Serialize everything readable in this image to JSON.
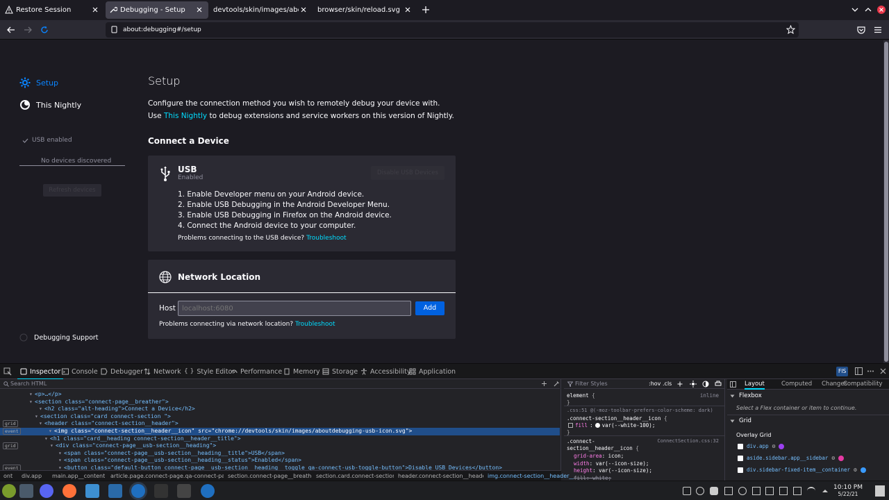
{
  "tabs": [
    {
      "label": "Restore Session",
      "active": false
    },
    {
      "label": "Debugging - Setup",
      "active": true
    },
    {
      "label": "devtools/skin/images/aboutdebugging",
      "active": false
    },
    {
      "label": "browser/skin/reload.svg",
      "active": false
    }
  ],
  "urlbar": {
    "url": "about:debugging#/setup"
  },
  "sidebar": {
    "items": [
      {
        "label": "Setup"
      },
      {
        "label": "This Nightly"
      }
    ],
    "usb_status": "USB enabled",
    "no_devices": "No devices discovered",
    "refresh_devices": "Refresh devices",
    "debugging_support": "Debugging Support"
  },
  "main": {
    "title": "Setup",
    "intro1": "Configure the connection method you wish to remotely debug your device with.",
    "intro2_pre": "Use ",
    "intro2_link": "This Nightly",
    "intro2_post": " to debug extensions and service workers on this version of Nightly.",
    "connect_heading": "Connect a Device",
    "usb": {
      "title": "USB",
      "status": "Enabled",
      "toggle_button": "Disable USB Devices",
      "steps": [
        "1.  Enable Developer menu on your Android device.",
        "2.  Enable USB Debugging in the Android Developer Menu.",
        "3.  Enable USB Debugging in Firefox on the Android device.",
        "4.  Connect the Android device to your computer."
      ],
      "problem_text": "Problems connecting to the USB device? ",
      "troubleshoot": "Troubleshoot"
    },
    "network": {
      "title": "Network Location",
      "host_label": "Host",
      "host_placeholder": "localhost:6080",
      "add_button": "Add",
      "problem_text": "Problems connecting via network location? ",
      "troubleshoot": "Troubleshoot"
    }
  },
  "devtools": {
    "tabs": [
      "Inspector",
      "Console",
      "Debugger",
      "Network",
      "Style Editor",
      "Performance",
      "Memory",
      "Storage",
      "Accessibility",
      "Application"
    ],
    "fis_label": "FIS",
    "search_placeholder": "Search HTML",
    "markup": [
      {
        "indent": 50,
        "text": "<p>…</p>"
      },
      {
        "indent": 50,
        "text": "<section class=\"connect-page__breather\">"
      },
      {
        "indent": 64,
        "text": "<h2 class=\"alt-heading\">Connect a Device</h2>"
      },
      {
        "indent": 58,
        "text": "<section class=\"card connect-section \">"
      },
      {
        "indent": 64,
        "text": "<header class=\"connect-section__header\">",
        "badge": "grid"
      },
      {
        "indent": 78,
        "text": "<img class=\"connect-section__header__icon\" src=\"chrome://devtools/skin/images/aboutdebugging-usb-icon.svg\">",
        "badge": "event",
        "selected": true
      },
      {
        "indent": 72,
        "text": "<h1 class=\"card__heading connect-section__header__title\">"
      },
      {
        "indent": 80,
        "text": "<div class=\"connect-page__usb-section__heading\">",
        "badge": "grid"
      },
      {
        "indent": 92,
        "text": "<span class=\"connect-page__usb-section__heading__title\">USB</span>"
      },
      {
        "indent": 92,
        "text": "<span class=\"connect-page__usb-section__heading__status\">Enabled</span>"
      },
      {
        "indent": 92,
        "text": "<button class=\"default-button connect-page__usb-section__heading__toggle qa-connect-usb-toggle-button\">Disable USB Devices</button>",
        "badge": "event"
      }
    ],
    "breadcrumbs": [
      "ont",
      "div.app",
      "main.app__content",
      "article.page.connect-page.qa-connect-pag…",
      "section.connect-page__breather",
      "section.card.connect-section.",
      "header.connect-section__header",
      "img.connect-section__header__icon"
    ],
    "rules": {
      "filter_placeholder": "Filter Styles",
      "hov": ":hov",
      "cls": ".cls",
      "element_label": "element",
      "element_source": "inline",
      "rule1_source": ".css:51 @(-moz-toolbar-prefers-color-scheme: dark)",
      "rule1_selector": ".connect-section__header__icon",
      "rule1_prop": "fill",
      "rule1_value": "var(--white-100);",
      "rule2_source": "ConnectSection.css:32",
      "rule2_selector1": ".connect-",
      "rule2_selector2": "section__header__icon",
      "rule2_props": [
        {
          "name": "grid-area",
          "value": "icon;"
        },
        {
          "name": "width",
          "value": "var(--icon-size);"
        },
        {
          "name": "height",
          "value": "var(--icon-size);"
        },
        {
          "name": "fill",
          "value": "white;"
        }
      ]
    },
    "layout": {
      "tabs": [
        "Layout",
        "Computed",
        "Changes",
        "Compatibility"
      ],
      "flexbox_title": "Flexbox",
      "flexbox_msg": "Select a Flex container or item to continue.",
      "grid_title": "Grid",
      "overlay_grid": "Overlay Grid",
      "grids": [
        {
          "label": "div.app",
          "color": "#9b40f0"
        },
        {
          "label": "aside.sidebar.app__sidebar",
          "color": "#e53aa4"
        },
        {
          "label": "div.sidebar-fixed-item__container",
          "color": "#3a9bff"
        }
      ]
    }
  },
  "taskbar": {
    "time": "10:10 PM",
    "date": "5/22/21"
  }
}
